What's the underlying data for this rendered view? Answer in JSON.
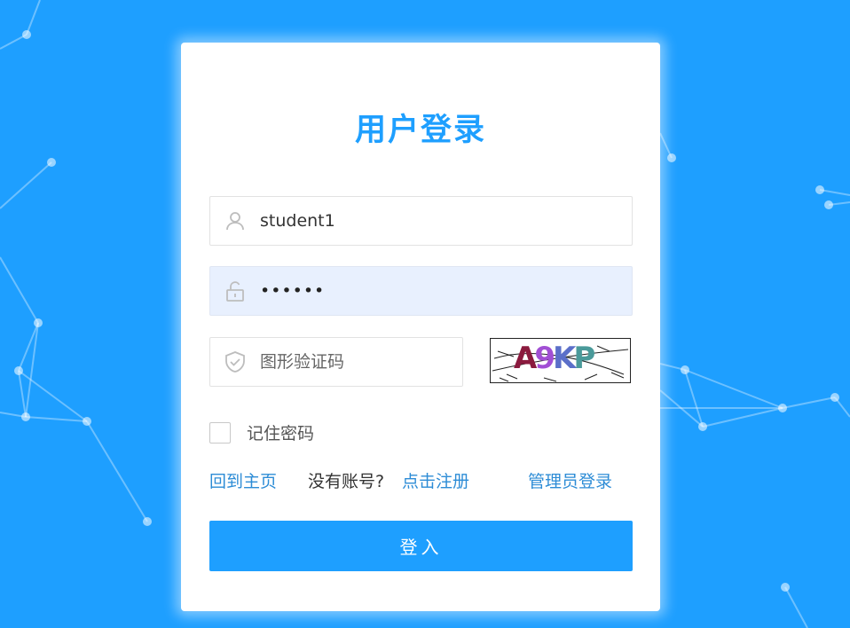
{
  "page": {
    "background": "#1e9fff",
    "accent": "#1e9fff"
  },
  "login": {
    "title": "用户登录",
    "username": {
      "value": "student1",
      "icon": "user-icon"
    },
    "password": {
      "value": "123456",
      "icon": "lock-icon"
    },
    "captcha": {
      "placeholder": "图形验证码",
      "icon": "shield-icon",
      "image_text": "A9KP"
    },
    "remember_label": "记住密码",
    "links": {
      "home": "回到主页",
      "no_account": "没有账号?",
      "register": "点击注册",
      "admin": "管理员登录"
    },
    "submit_label": "登入"
  }
}
